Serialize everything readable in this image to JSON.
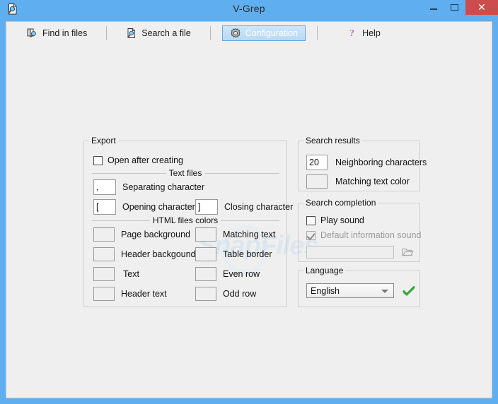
{
  "window": {
    "title": "V-Grep",
    "icon": "document-search-icon",
    "minimize_label": "–",
    "maximize_label": "□",
    "close_label": "✕",
    "frame_color": "#5faeef",
    "close_color": "#cb4d4d",
    "client_color": "#efefef"
  },
  "toolbar": {
    "items": [
      {
        "label": "Find in files",
        "icon": "find-in-files-icon",
        "selected": false
      },
      {
        "label": "Search a file",
        "icon": "search-a-file-icon",
        "selected": false
      },
      {
        "label": "Configuration",
        "icon": "gear-icon",
        "selected": true
      },
      {
        "label": "Help",
        "icon": "question-mark-icon",
        "selected": false
      }
    ]
  },
  "export_group": {
    "title": "Export",
    "open_after_creating": {
      "label": "Open after creating",
      "checked": false
    },
    "text_files_divider": "Text files",
    "separating_character": {
      "value": ",",
      "label": "Separating character"
    },
    "opening_character": {
      "value": "[",
      "label": "Opening character"
    },
    "closing_character": {
      "value": "]",
      "label": "Closing character"
    },
    "html_colors_divider": "HTML files colors",
    "color_items": [
      {
        "label": "Page background",
        "color": "#efefef"
      },
      {
        "label": "Matching text",
        "color": "#efefef"
      },
      {
        "label": "Header backgound",
        "color": "#efefef"
      },
      {
        "label": "Table border",
        "color": "#efefef"
      },
      {
        "label": "Text",
        "color": "#efefef"
      },
      {
        "label": "Even row",
        "color": "#efefef"
      },
      {
        "label": "Header text",
        "color": "#efefef"
      },
      {
        "label": "Odd row",
        "color": "#efefef"
      }
    ]
  },
  "search_results_group": {
    "title": "Search results",
    "neighboring_characters": {
      "value": "20",
      "label": "Neighboring characters"
    },
    "matching_text_color": {
      "label": "Matching text color",
      "color": "#efefef"
    }
  },
  "search_completion_group": {
    "title": "Search completion",
    "play_sound": {
      "label": "Play sound",
      "checked": false
    },
    "default_information_sound": {
      "label": "Default information sound",
      "checked": true,
      "disabled": true
    },
    "sound_file": {
      "value": "",
      "placeholder": ""
    },
    "browse_icon": "open-folder-icon"
  },
  "language_group": {
    "title": "Language",
    "selected": "English",
    "options": [
      "English"
    ],
    "confirm_icon": "green-check-icon"
  },
  "watermark": {
    "text": "SnapFiles"
  }
}
